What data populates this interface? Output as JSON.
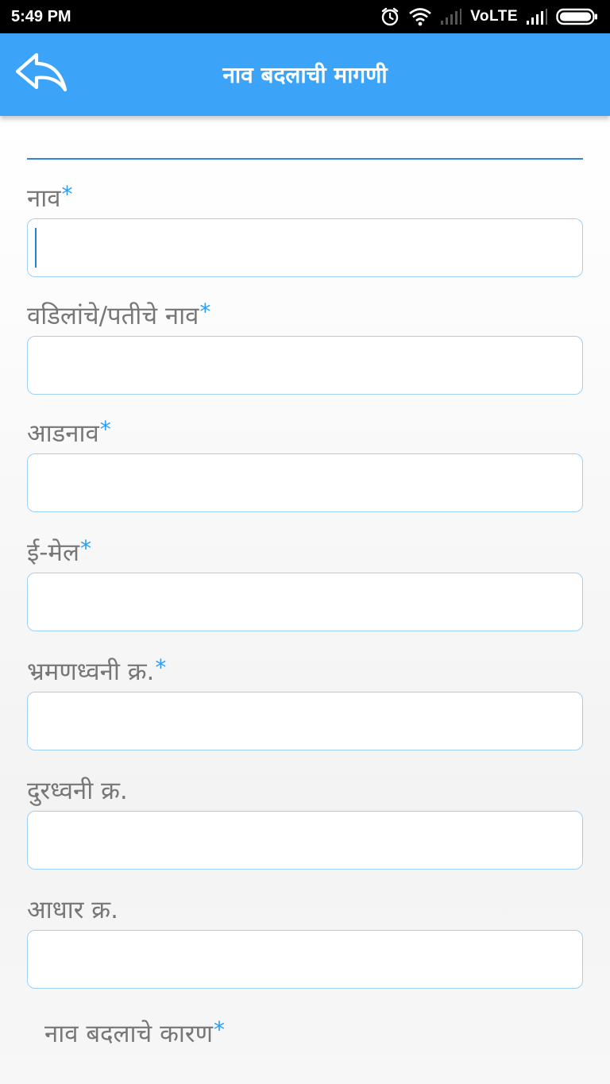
{
  "status_bar": {
    "time": "5:49 PM",
    "network": "VoLTE",
    "icons": [
      "alarm-icon",
      "wifi-icon",
      "signal-icon",
      "signal-icon",
      "battery-icon"
    ]
  },
  "app_bar": {
    "title": "नाव बदलाची मागणी",
    "back_icon": "back-arrow-icon"
  },
  "form": {
    "fields": [
      {
        "label": "नाव",
        "required_mark": "*",
        "value": ""
      },
      {
        "label": "वडिलांचे/पतीचे नाव",
        "required_mark": "*",
        "value": ""
      },
      {
        "label": "आडनाव",
        "required_mark": "*",
        "value": ""
      },
      {
        "label": "ई-मेल",
        "required_mark": "*",
        "value": ""
      },
      {
        "label": "भ्रमणध्वनी क्र.",
        "required_mark": "*",
        "value": ""
      },
      {
        "label": "दुरध्वनी क्र.",
        "value": ""
      },
      {
        "label": "आधार क्र.",
        "value": ""
      }
    ],
    "reason": {
      "label": "नाव बदलाचे कारण",
      "required_mark": "*"
    }
  },
  "colors": {
    "app_bar": "#3ba4f8",
    "accent": "#2a9df4",
    "input_border": "#9fd0f6",
    "label_text": "#777777"
  }
}
